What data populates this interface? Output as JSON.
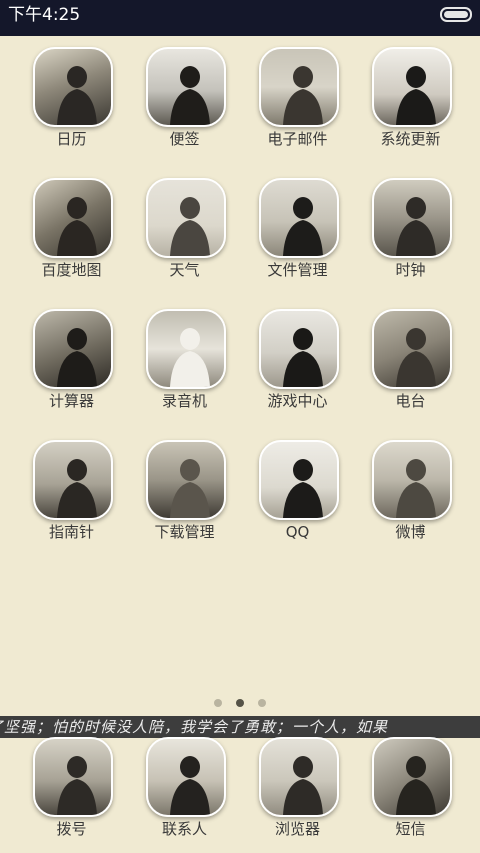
{
  "status": {
    "time": "下午4:25",
    "battery_level": 1.0
  },
  "colors": {
    "background": "#f0ead2",
    "status_bar": "#14172a",
    "ticker_bg": "#3d3d3d",
    "label": "#3a3a3a"
  },
  "grid": {
    "apps": [
      {
        "label": "日历",
        "icon": "calendar-icon"
      },
      {
        "label": "便签",
        "icon": "notes-icon"
      },
      {
        "label": "电子邮件",
        "icon": "email-icon"
      },
      {
        "label": "系统更新",
        "icon": "system-update-icon"
      },
      {
        "label": "百度地图",
        "icon": "baidu-map-icon"
      },
      {
        "label": "天气",
        "icon": "weather-icon"
      },
      {
        "label": "文件管理",
        "icon": "file-manager-icon"
      },
      {
        "label": "时钟",
        "icon": "clock-icon"
      },
      {
        "label": "计算器",
        "icon": "calculator-icon"
      },
      {
        "label": "录音机",
        "icon": "recorder-icon"
      },
      {
        "label": "游戏中心",
        "icon": "game-center-icon"
      },
      {
        "label": "电台",
        "icon": "radio-icon"
      },
      {
        "label": "指南针",
        "icon": "compass-icon"
      },
      {
        "label": "下载管理",
        "icon": "download-manager-icon"
      },
      {
        "label": "QQ",
        "icon": "qq-icon"
      },
      {
        "label": "微博",
        "icon": "weibo-icon"
      }
    ]
  },
  "pager": {
    "pages": 3,
    "current_page": 2
  },
  "ticker": {
    "text": "了坚强；怕的时候没人陪，我学会了勇敢；一个人，如果"
  },
  "dock": {
    "apps": [
      {
        "label": "拨号",
        "icon": "dialer-icon"
      },
      {
        "label": "联系人",
        "icon": "contacts-icon"
      },
      {
        "label": "浏览器",
        "icon": "browser-icon"
      },
      {
        "label": "短信",
        "icon": "messages-icon"
      }
    ]
  }
}
